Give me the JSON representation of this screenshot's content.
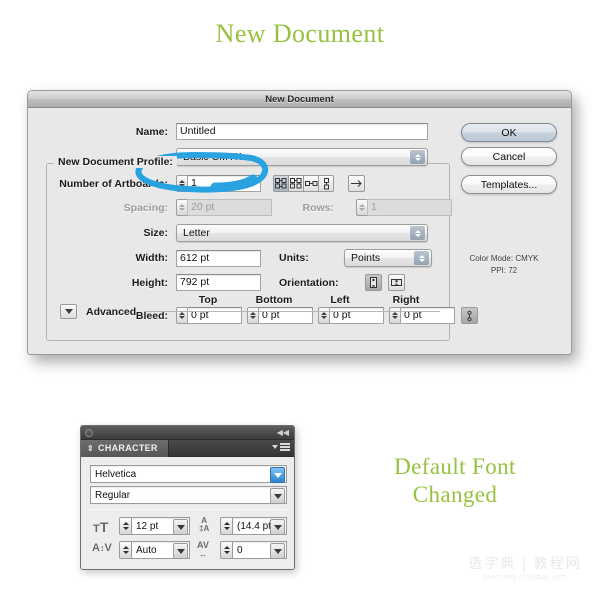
{
  "annotations": {
    "title_note": "New Document",
    "font_note": "Default Font\nChanged"
  },
  "dialog": {
    "title": "New Document",
    "group_legend": "New Document Profile",
    "fields": {
      "name_label": "Name:",
      "name_value": "Untitled",
      "profile_label": "New Document Profile:",
      "profile_value": "Basic CMYK",
      "artboards_label": "Number of Artboards:",
      "artboards_value": "1",
      "spacing_label": "Spacing:",
      "spacing_value": "20 pt",
      "rows_label": "Rows:",
      "rows_value": "1",
      "size_label": "Size:",
      "size_value": "Letter",
      "width_label": "Width:",
      "width_value": "612 pt",
      "units_label": "Units:",
      "units_value": "Points",
      "height_label": "Height:",
      "height_value": "792 pt",
      "orientation_label": "Orientation:",
      "bleed_label": "Bleed:",
      "bleed_top_header": "Top",
      "bleed_bottom_header": "Bottom",
      "bleed_left_header": "Left",
      "bleed_right_header": "Right",
      "bleed_top_value": "0 pt",
      "bleed_bottom_value": "0 pt",
      "bleed_left_value": "0 pt",
      "bleed_right_value": "0 pt"
    },
    "advanced_label": "Advanced",
    "buttons": {
      "ok": "OK",
      "cancel": "Cancel",
      "templates": "Templates..."
    },
    "info": {
      "color_mode": "Color Mode: CMYK",
      "ppi": "PPI: 72"
    }
  },
  "character_panel": {
    "tab_label": "CHARACTER",
    "font_family": "Helvetica",
    "font_style": "Regular",
    "font_size": "12 pt",
    "leading": "(14.4 pt)",
    "kerning": "Auto",
    "tracking": "0"
  },
  "watermark": {
    "main": "造字典 | 教程网",
    "url": "jiaocheng.cfuzidian.com"
  },
  "colors": {
    "accent_green": "#96c23e",
    "annotation_blue": "#29a3e0",
    "dialog_bg": "#e8e8e8",
    "panel_dark": "#454545"
  }
}
